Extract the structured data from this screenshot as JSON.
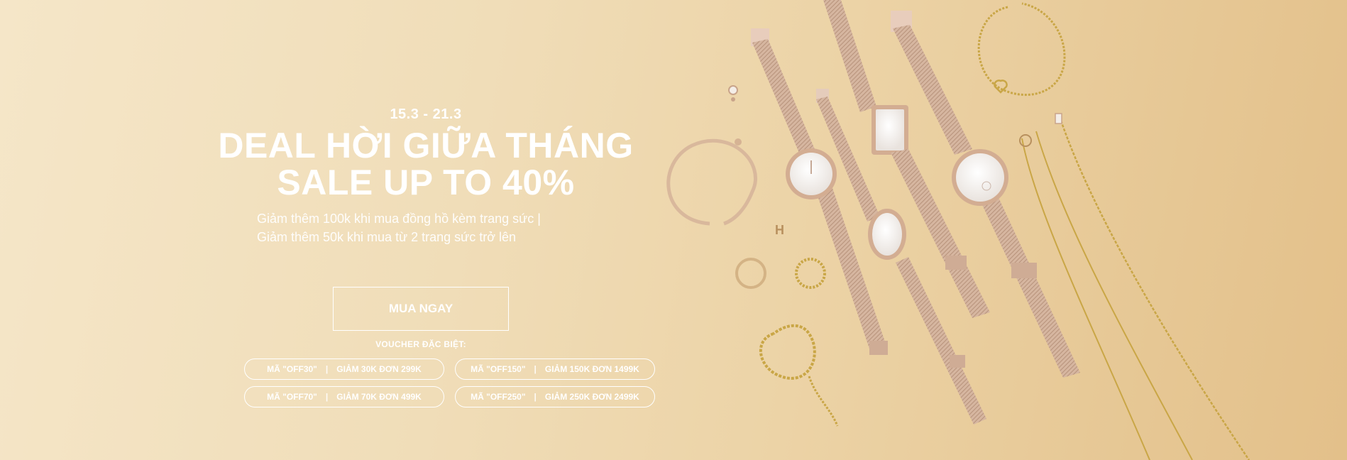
{
  "banner": {
    "date_range": "15.3 - 21.3",
    "title_line1": "DEAL HỜI GIỮA THÁNG",
    "title_line2": "SALE UP TO 40%",
    "subtitle_line1": "Giảm thêm 100k khi mua đồng hồ kèm trang sức |",
    "subtitle_line2": "Giảm thêm 50k khi mua từ 2 trang sức trở lên",
    "cta_label": "MUA NGAY",
    "voucher_heading": "VOUCHER ĐẶC BIỆT:",
    "vouchers": [
      {
        "code": "MÃ \"OFF30\"",
        "separator": "|",
        "desc": "GIẢM 30K ĐƠN 299K"
      },
      {
        "code": "MÃ \"OFF150\"",
        "separator": "|",
        "desc": "GIẢM 150K ĐƠN 1499K"
      },
      {
        "code": "MÃ \"OFF70\"",
        "separator": "|",
        "desc": "GIẢM 70K ĐƠN 499K"
      },
      {
        "code": "MÃ \"OFF250\"",
        "separator": "|",
        "desc": "GIẢM 250K ĐƠN 2499K"
      }
    ]
  },
  "colors": {
    "background": "#efdab3",
    "text": "#ffffff",
    "rose_gold": "#c9a48a",
    "gold": "#c9a646"
  }
}
